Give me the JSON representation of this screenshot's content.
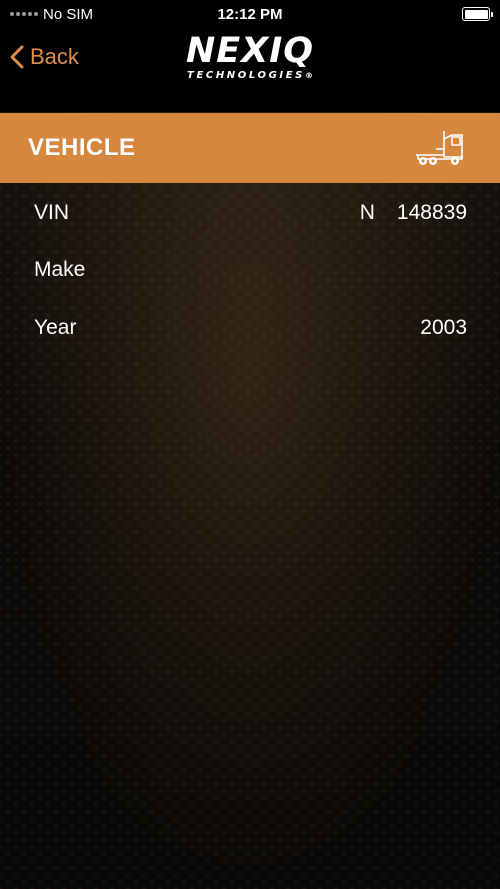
{
  "status_bar": {
    "carrier": "No SIM",
    "time": "12:12 PM",
    "battery_level": 1.0
  },
  "nav": {
    "back_label": "Back",
    "logo_main": "NEXIQ",
    "logo_sub": "TECHNOLOGIES",
    "logo_mark": "®"
  },
  "section": {
    "title": "VEHICLE",
    "icon": "semi-truck-icon"
  },
  "rows": [
    {
      "label": "VIN",
      "value_prefix": "N",
      "value": "148839"
    },
    {
      "label": "Make",
      "value_prefix": "",
      "value": ""
    },
    {
      "label": "Year",
      "value_prefix": "",
      "value": "2003"
    }
  ],
  "colors": {
    "accent": "#d6873f",
    "back_link": "#e0904a",
    "text": "#ffffff",
    "bar_background": "#000000"
  }
}
